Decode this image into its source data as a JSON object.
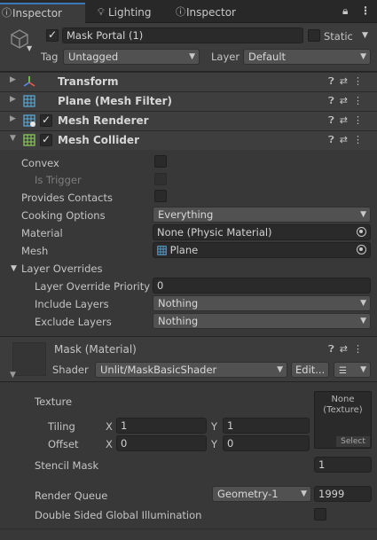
{
  "tabs": [
    {
      "label": "Inspector",
      "icon": "info-icon",
      "active": true
    },
    {
      "label": "Lighting",
      "icon": "bulb-icon",
      "active": false
    },
    {
      "label": "Inspector",
      "icon": "info-icon",
      "active": false
    }
  ],
  "header": {
    "object_name": "Mask Portal (1)",
    "static_label": "Static",
    "tag_label": "Tag",
    "tag_value": "Untagged",
    "layer_label": "Layer",
    "layer_value": "Default"
  },
  "components": [
    {
      "name": "Transform",
      "has_checkbox": false,
      "expanded": false,
      "icon": "transform-icon"
    },
    {
      "name": "Plane (Mesh Filter)",
      "has_checkbox": false,
      "expanded": false,
      "icon": "mesh-filter-icon"
    },
    {
      "name": "Mesh Renderer",
      "has_checkbox": true,
      "expanded": false,
      "icon": "mesh-renderer-icon"
    },
    {
      "name": "Mesh Collider",
      "has_checkbox": true,
      "expanded": true,
      "icon": "mesh-collider-icon"
    }
  ],
  "collider": {
    "convex_label": "Convex",
    "is_trigger_label": "Is Trigger",
    "provides_contacts_label": "Provides Contacts",
    "cooking_options_label": "Cooking Options",
    "cooking_options_value": "Everything",
    "material_label": "Material",
    "material_value": "None (Physic Material)",
    "mesh_label": "Mesh",
    "mesh_value": "Plane",
    "layer_overrides_label": "Layer Overrides",
    "layer_override_priority_label": "Layer Override Priority",
    "layer_override_priority_value": "0",
    "include_layers_label": "Include Layers",
    "include_layers_value": "Nothing",
    "exclude_layers_label": "Exclude Layers",
    "exclude_layers_value": "Nothing"
  },
  "material": {
    "title": "Mask (Material)",
    "shader_label": "Shader",
    "shader_value": "Unlit/MaskBasicShader",
    "edit_label": "Edit...",
    "texture_label": "Texture",
    "texture_none": "None",
    "texture_type": "(Texture)",
    "select_label": "Select",
    "tiling_label": "Tiling",
    "offset_label": "Offset",
    "x_label": "X",
    "y_label": "Y",
    "tiling_x": "1",
    "tiling_y": "1",
    "offset_x": "0",
    "offset_y": "0",
    "stencil_mask_label": "Stencil Mask",
    "stencil_mask_value": "1",
    "render_queue_label": "Render Queue",
    "render_queue_preset": "Geometry-1",
    "render_queue_value": "1999",
    "double_sided_gi_label": "Double Sided Global Illumination"
  }
}
